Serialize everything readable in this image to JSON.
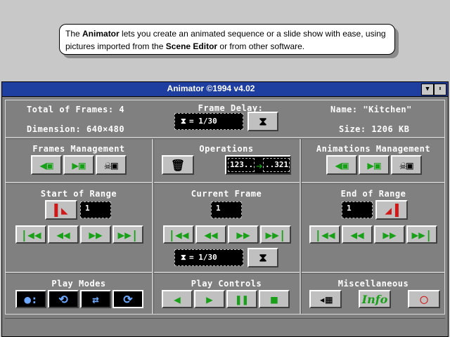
{
  "tooltip": {
    "p1": "The ",
    "b1": "Animator",
    "p2": " lets you create an animated sequence or a slide show with ease, using pictures imported from the ",
    "b2": "Scene Editor",
    "p3": " or from other software."
  },
  "window": {
    "title": "Animator ©1994     v4.02"
  },
  "info": {
    "total_frames": "Total of Frames: 4",
    "dimension": "Dimension: 640×480",
    "frame_delay_label": "Frame Delay:",
    "delay_value": "= 1/30",
    "name": "Name: \"Kitchen\"",
    "size": "Size: 1206 KB"
  },
  "sections": {
    "frames_mgmt": "Frames Management",
    "operations": "Operations",
    "anim_mgmt": "Animations Management",
    "start_range": "Start of Range",
    "current_frame": "Current Frame",
    "end_range": "End of Range",
    "play_modes": "Play Modes",
    "play_controls": "Play Controls",
    "misc": "Miscellaneous"
  },
  "values": {
    "start_frame": "1",
    "current_frame": "1",
    "end_frame": "1",
    "current_delay": "= 1/30",
    "ops_from": "123..",
    "ops_to": "..321",
    "info_btn": "Info"
  },
  "colors": {
    "titlebar": "#1f3fa0",
    "panel": "#808080",
    "green_icon": "#18a018",
    "red_icon": "#d01818"
  }
}
